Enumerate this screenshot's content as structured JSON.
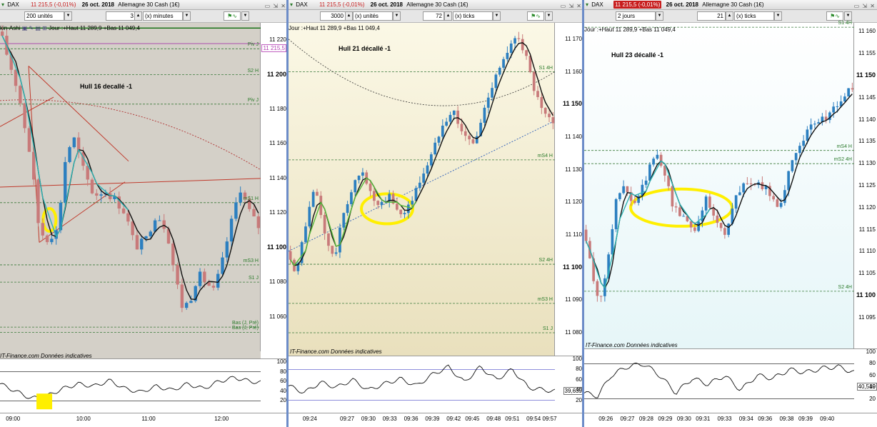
{
  "panels": [
    {
      "id": "p1",
      "title": {
        "instrument": "DAX",
        "price": "11 215,5 (-0,01%)",
        "date": "26 oct. 2018",
        "market": "Allemagne 30 Cash (1€)"
      },
      "toolbar": {
        "field1": "200 unités",
        "field2": "3",
        "field3": "(x) minutes"
      },
      "subheader": {
        "prefix": "kin-Ashi",
        "hl": "Jour :+Haut 11 289,9 +Bas 11 049,4"
      },
      "annotation": "Hull 16 decallé -1",
      "current_price": "11 215,5",
      "footer": "IT-Finance.com  Données indicatives",
      "chart_data": {
        "type": "candlestick",
        "title": "Hull 16 decallé -1",
        "ylim": [
          11040,
          11230
        ],
        "y_ticks": [
          11060,
          11080,
          11100,
          11120,
          11140,
          11160,
          11180,
          11200,
          11220
        ],
        "x_ticks": [
          "09:00",
          "10:00",
          "11:00",
          "12:00"
        ]
      },
      "levels": [
        {
          "label": "Piv J",
          "value": 11215
        },
        {
          "label": "S2 H",
          "value": 11200
        },
        {
          "label": "Piv J",
          "value": 11183
        },
        {
          "label": "mS1 H",
          "value": 11126
        },
        {
          "label": "mS3 H",
          "value": 11090
        },
        {
          "label": "S1 J",
          "value": 11080
        },
        {
          "label": "Bas (J, Pré)",
          "value": 11054
        },
        {
          "label": "Bas (J, Pré)",
          "value": 11051
        }
      ],
      "osc_ticks": [
        "100",
        "80",
        "60",
        "40",
        "20"
      ]
    },
    {
      "id": "p2",
      "title": {
        "instrument": "DAX",
        "price": "11 215,5 (-0,01%)",
        "date": "26 oct. 2018",
        "market": "Allemagne 30 Cash (1€)"
      },
      "toolbar": {
        "field1": "3000",
        "field2": "(x) unités",
        "field3": "72",
        "field4": "(x) ticks"
      },
      "subheader": {
        "hl": "Jour :+Haut 11 289,9 +Bas 11 049,4"
      },
      "annotation": "Hull 21 décallé -1",
      "footer": "IT-Finance.com  Données indicatives",
      "chart_data": {
        "type": "candlestick",
        "title": "Hull 21 décallé -1",
        "ylim": [
          11073,
          11175
        ],
        "y_ticks": [
          11080,
          11090,
          11100,
          11110,
          11120,
          11130,
          11140,
          11150,
          11160,
          11170
        ],
        "x_ticks": [
          "09:24",
          "09:27",
          "09:30",
          "09:33",
          "09:36",
          "09:39",
          "09:42",
          "09:45",
          "09:48",
          "09:51",
          "09:54",
          "09:57"
        ]
      },
      "levels": [
        {
          "label": "S1 4H",
          "value": 11160
        },
        {
          "label": "mS4 H",
          "value": 11133
        },
        {
          "label": "S2 4H",
          "value": 11101
        },
        {
          "label": "mS3 H",
          "value": 11089
        },
        {
          "label": "S1 J",
          "value": 11080
        }
      ],
      "osc_ticks": [
        "100",
        "80",
        "60",
        "40",
        "20"
      ],
      "osc_value": "39,639"
    },
    {
      "id": "p3",
      "title": {
        "instrument": "DAX",
        "price": "11 215,5 (-0,01%)",
        "date": "26 oct. 2018",
        "market": "Allemagne 30 Cash (1€)"
      },
      "toolbar": {
        "field1": "2 jours",
        "field2": "21",
        "field3": "(x) ticks"
      },
      "subheader": {
        "hl": "Jour :+Haut 11 289,9 +Bas 11 049,4"
      },
      "annotation": "Hull 23 décallé -1",
      "footer": "IT-Finance.com  Données indicatives",
      "chart_data": {
        "type": "candlestick",
        "title": "Hull 23 décallé -1",
        "ylim": [
          11088,
          11162
        ],
        "y_ticks": [
          11095,
          11100,
          11105,
          11110,
          11115,
          11120,
          11125,
          11130,
          11135,
          11140,
          11145,
          11150,
          11155,
          11160
        ],
        "x_ticks": [
          "09:26",
          "09:27",
          "09:28",
          "09:29",
          "09:30",
          "09:31",
          "09:33",
          "09:34",
          "09:36",
          "09:38",
          "09:39",
          "09:40"
        ]
      },
      "levels": [
        {
          "label": "S1 4H",
          "value": 11161
        },
        {
          "label": "mS4 H",
          "value": 11133
        },
        {
          "label": "mS2 4H",
          "value": 11130
        },
        {
          "label": "S2 4H",
          "value": 11101
        }
      ],
      "osc_ticks": [
        "100",
        "80",
        "60",
        "40",
        "20"
      ],
      "osc_value": "40,519"
    }
  ],
  "colors": {
    "up": "#2c7fc0",
    "down": "#c87a7a",
    "hull": "#101010",
    "hull2": "#2fb3b3",
    "highlight": "#ffef00",
    "level": "#3a7a3a"
  }
}
